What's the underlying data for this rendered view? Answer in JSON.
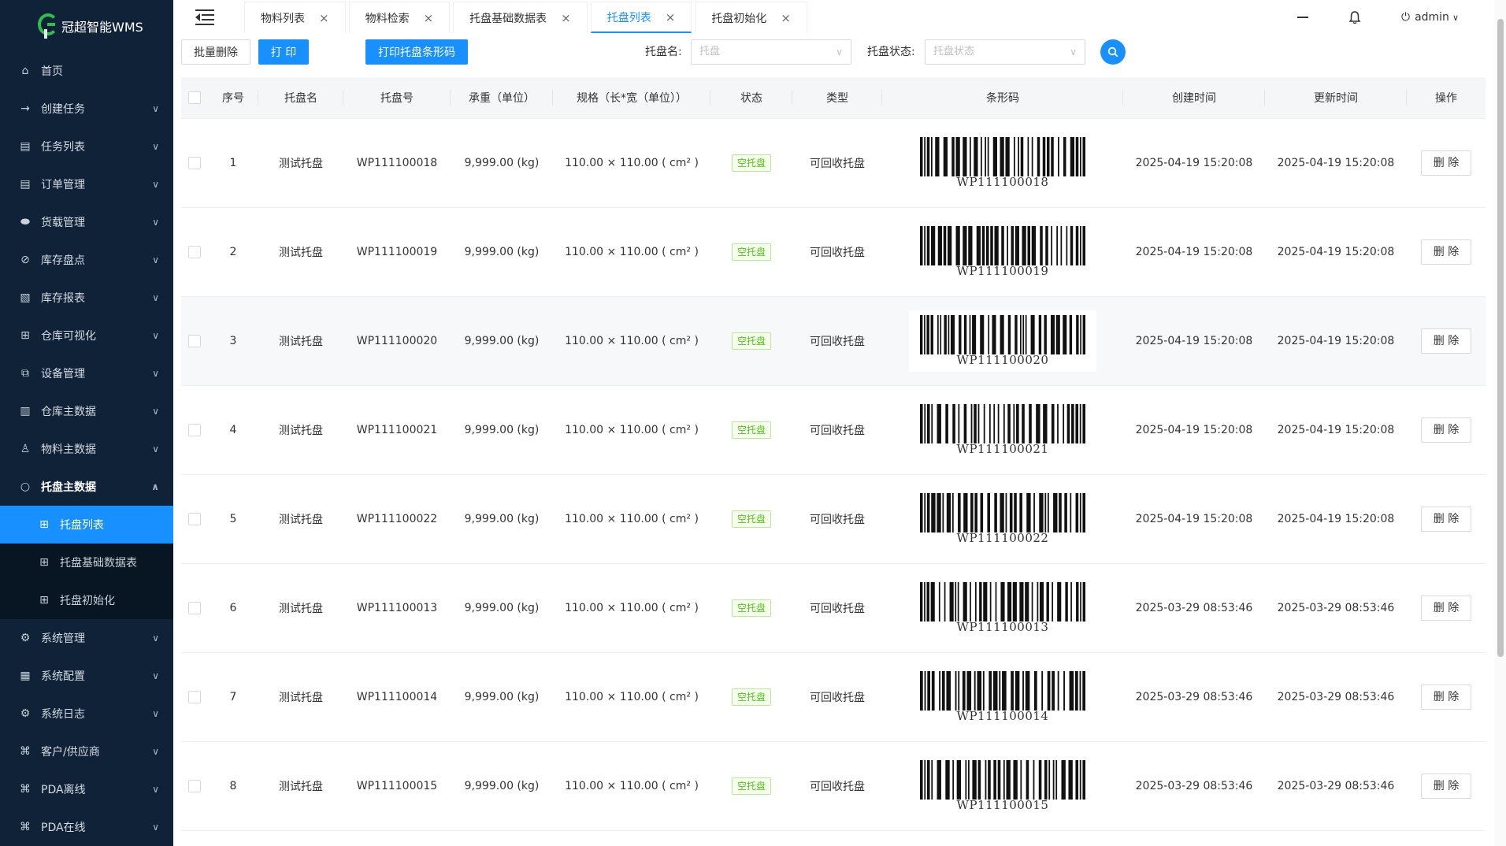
{
  "app": {
    "title": "冠超智能WMS"
  },
  "sidebar": {
    "items": [
      {
        "label": "首页",
        "icon": "home-icon",
        "glyph": "⌂",
        "chevron": false
      },
      {
        "label": "创建任务",
        "icon": "arrow-right-icon",
        "glyph": "→",
        "chevron": true
      },
      {
        "label": "任务列表",
        "icon": "list-icon",
        "glyph": "▤",
        "chevron": true
      },
      {
        "label": "订单管理",
        "icon": "list-icon",
        "glyph": "▤",
        "chevron": true
      },
      {
        "label": "货载管理",
        "icon": "database-icon",
        "glyph": "⬬",
        "chevron": true
      },
      {
        "label": "库存盘点",
        "icon": "compass-icon",
        "glyph": "⊘",
        "chevron": true
      },
      {
        "label": "库存报表",
        "icon": "report-icon",
        "glyph": "▧",
        "chevron": true
      },
      {
        "label": "仓库可视化",
        "icon": "grid-icon",
        "glyph": "⊞",
        "chevron": true
      },
      {
        "label": "设备管理",
        "icon": "device-icon",
        "glyph": "⧉",
        "chevron": true
      },
      {
        "label": "仓库主数据",
        "icon": "bar-chart-icon",
        "glyph": "▥",
        "chevron": true
      },
      {
        "label": "物料主数据",
        "icon": "flask-icon",
        "glyph": "♙",
        "chevron": true
      },
      {
        "label": "托盘主数据",
        "icon": "circle-icon",
        "glyph": "○",
        "chevron": true,
        "open": true
      }
    ],
    "sub_items": [
      {
        "label": "托盘列表",
        "active": true
      },
      {
        "label": "托盘基础数据表",
        "active": false
      },
      {
        "label": "托盘初始化",
        "active": false
      }
    ],
    "bottom_items": [
      {
        "label": "系统管理",
        "icon": "settings-icon",
        "glyph": "⚙"
      },
      {
        "label": "系统配置",
        "icon": "apps-icon",
        "glyph": "▦"
      },
      {
        "label": "系统日志",
        "icon": "log-icon",
        "glyph": "⚙"
      },
      {
        "label": "客户/供应商",
        "icon": "cluster-icon",
        "glyph": "⌘"
      },
      {
        "label": "PDA离线",
        "icon": "cluster-icon",
        "glyph": "⌘"
      },
      {
        "label": "PDA在线",
        "icon": "cluster-icon",
        "glyph": "⌘"
      }
    ]
  },
  "tabs": [
    {
      "label": "物料列表",
      "active": false
    },
    {
      "label": "物料检索",
      "active": false
    },
    {
      "label": "托盘基础数据表",
      "active": false
    },
    {
      "label": "托盘列表",
      "active": true
    },
    {
      "label": "托盘初始化",
      "active": false
    }
  ],
  "header": {
    "user": "admin"
  },
  "toolbar": {
    "batch_delete": "批量删除",
    "print": "打 印",
    "print_barcode": "打印托盘条形码",
    "name_label": "托盘名:",
    "name_placeholder": "托盘",
    "status_label": "托盘状态:",
    "status_placeholder": "托盘状态"
  },
  "table": {
    "columns": [
      "序号",
      "托盘名",
      "托盘号",
      "承重（单位）",
      "规格（长*宽（单位））",
      "状态",
      "类型",
      "条形码",
      "创建时间",
      "更新时间",
      "操作"
    ],
    "rows": [
      {
        "idx": "1",
        "name": "测试托盘",
        "code": "WP111100018",
        "load": "9,999.00 (kg)",
        "spec": "110.00 × 110.00 ( cm² )",
        "status": "空托盘",
        "type": "可回收托盘",
        "barcode": "WP111100018",
        "created": "2025-04-19 15:20:08",
        "updated": "2025-04-19 15:20:08",
        "action": "删 除"
      },
      {
        "idx": "2",
        "name": "测试托盘",
        "code": "WP111100019",
        "load": "9,999.00 (kg)",
        "spec": "110.00 × 110.00 ( cm² )",
        "status": "空托盘",
        "type": "可回收托盘",
        "barcode": "WP111100019",
        "created": "2025-04-19 15:20:08",
        "updated": "2025-04-19 15:20:08",
        "action": "删 除"
      },
      {
        "idx": "3",
        "name": "测试托盘",
        "code": "WP111100020",
        "load": "9,999.00 (kg)",
        "spec": "110.00 × 110.00 ( cm² )",
        "status": "空托盘",
        "type": "可回收托盘",
        "barcode": "WP111100020",
        "created": "2025-04-19 15:20:08",
        "updated": "2025-04-19 15:20:08",
        "action": "删 除"
      },
      {
        "idx": "4",
        "name": "测试托盘",
        "code": "WP111100021",
        "load": "9,999.00 (kg)",
        "spec": "110.00 × 110.00 ( cm² )",
        "status": "空托盘",
        "type": "可回收托盘",
        "barcode": "WP111100021",
        "created": "2025-04-19 15:20:08",
        "updated": "2025-04-19 15:20:08",
        "action": "删 除"
      },
      {
        "idx": "5",
        "name": "测试托盘",
        "code": "WP111100022",
        "load": "9,999.00 (kg)",
        "spec": "110.00 × 110.00 ( cm² )",
        "status": "空托盘",
        "type": "可回收托盘",
        "barcode": "WP111100022",
        "created": "2025-04-19 15:20:08",
        "updated": "2025-04-19 15:20:08",
        "action": "删 除"
      },
      {
        "idx": "6",
        "name": "测试托盘",
        "code": "WP111100013",
        "load": "9,999.00 (kg)",
        "spec": "110.00 × 110.00 ( cm² )",
        "status": "空托盘",
        "type": "可回收托盘",
        "barcode": "WP111100013",
        "created": "2025-03-29 08:53:46",
        "updated": "2025-03-29 08:53:46",
        "action": "删 除"
      },
      {
        "idx": "7",
        "name": "测试托盘",
        "code": "WP111100014",
        "load": "9,999.00 (kg)",
        "spec": "110.00 × 110.00 ( cm² )",
        "status": "空托盘",
        "type": "可回收托盘",
        "barcode": "WP111100014",
        "created": "2025-03-29 08:53:46",
        "updated": "2025-03-29 08:53:46",
        "action": "删 除"
      },
      {
        "idx": "8",
        "name": "测试托盘",
        "code": "WP111100015",
        "load": "9,999.00 (kg)",
        "spec": "110.00 × 110.00 ( cm² )",
        "status": "空托盘",
        "type": "可回收托盘",
        "barcode": "WP111100015",
        "created": "2025-03-29 08:53:46",
        "updated": "2025-03-29 08:53:46",
        "action": "删 除"
      }
    ]
  },
  "colors": {
    "sidebar_bg": "#0f2238",
    "accent": "#1890ff",
    "tag_green": "#52c41a"
  }
}
